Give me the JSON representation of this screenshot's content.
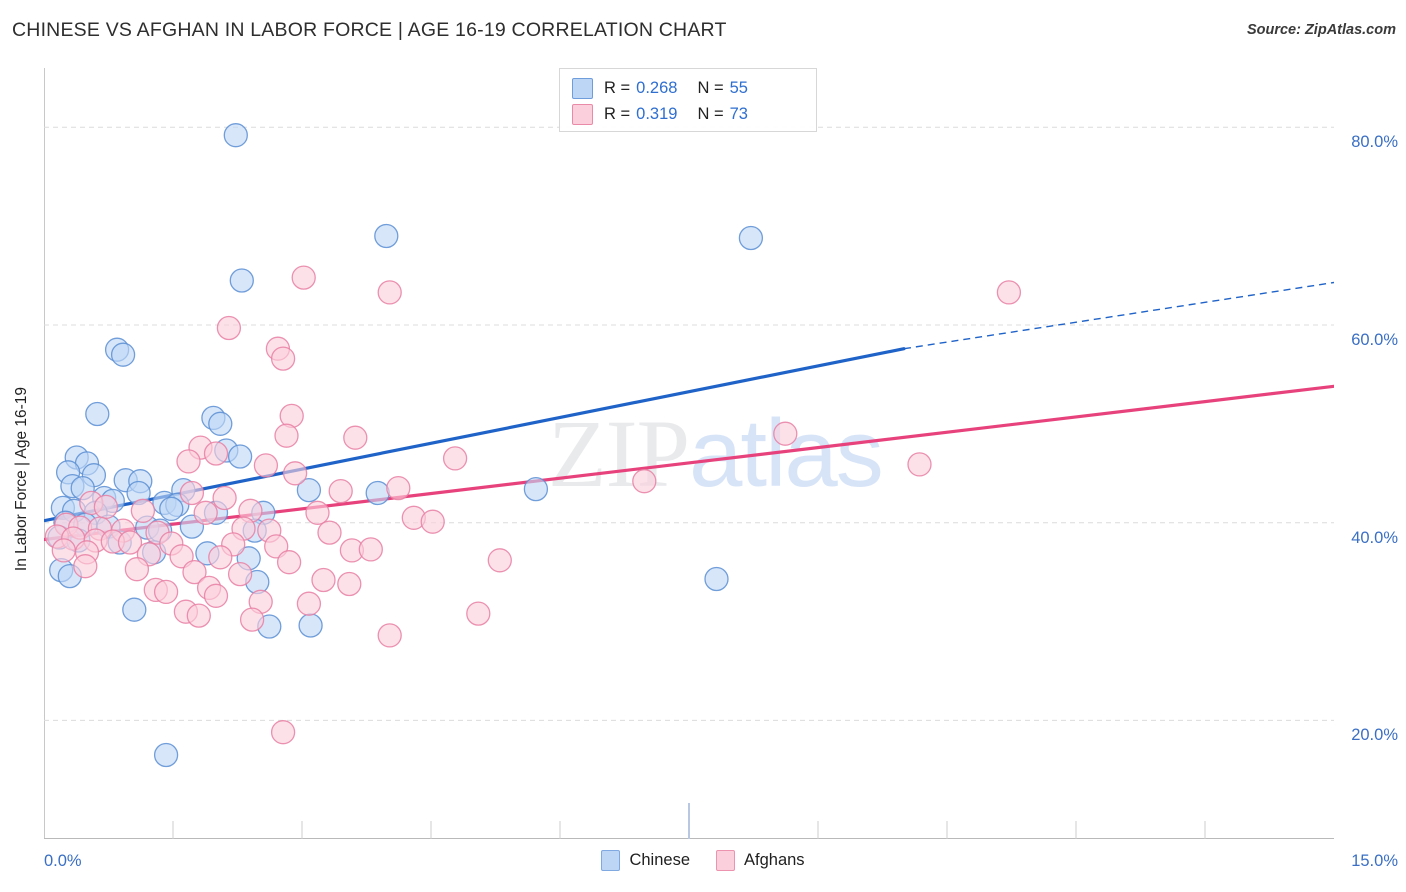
{
  "header": {
    "title": "CHINESE VS AFGHAN IN LABOR FORCE | AGE 16-19 CORRELATION CHART",
    "source": "Source: ZipAtlas.com"
  },
  "watermark": {
    "part1": "ZIP",
    "part2": "atlas"
  },
  "stat_legend": {
    "rows": [
      {
        "series": "Chinese",
        "r_key": "R =",
        "r_value": "0.268",
        "n_key": "N =",
        "n_value": "55",
        "color": "#bed6f5"
      },
      {
        "series": "Afghans",
        "r_key": "R =",
        "r_value": "0.319",
        "n_key": "N =",
        "n_value": "73",
        "color": "#fbcfdc"
      }
    ]
  },
  "series_legend": [
    {
      "label": "Chinese",
      "color": "#bed6f5"
    },
    {
      "label": "Afghans",
      "color": "#fbcfdc"
    }
  ],
  "axes": {
    "y_title": "In Labor Force | Age 16-19",
    "y_ticks": [
      "80.0%",
      "60.0%",
      "40.0%",
      "20.0%"
    ],
    "x_min_label": "0.0%",
    "x_max_label": "15.0%"
  },
  "colors": {
    "blue_fill": "#bed6f5",
    "blue_stroke": "#5b8ed4",
    "pink_fill": "#fbcfdc",
    "pink_stroke": "#e87fa3",
    "blue_trend": "#1f62c8",
    "pink_trend": "#e8427c",
    "tick_text": "#3a6fc4",
    "gridline": "#dcdcdc"
  },
  "chart_data": {
    "type": "scatter",
    "title": "CHINESE VS AFGHAN IN LABOR FORCE | AGE 16-19 CORRELATION CHART",
    "xlabel": "",
    "ylabel": "In Labor Force | Age 16-19",
    "xlim": [
      0.0,
      15.0
    ],
    "ylim": [
      8.0,
      86.0
    ],
    "x_unit": "%",
    "y_unit": "%",
    "grid": true,
    "y_gridlines": [
      20.0,
      40.0,
      60.0,
      80.0
    ],
    "legend_position": "bottom-center",
    "series": [
      {
        "name": "Chinese",
        "color": "#bed6f5",
        "stroke": "#5b8ed4",
        "R": 0.268,
        "N": 55,
        "trendline": {
          "x0": 0.0,
          "y0": 40.2,
          "x1": 10.0,
          "y1": 57.6,
          "solid_to_x": 10.0,
          "dash_to_x": 15.0,
          "dash_y1": 64.3
        },
        "points": [
          [
            2.23,
            79.2
          ],
          [
            3.98,
            69.0
          ],
          [
            8.22,
            68.8
          ],
          [
            2.3,
            64.5
          ],
          [
            0.85,
            57.5
          ],
          [
            0.92,
            57.0
          ],
          [
            0.62,
            51.0
          ],
          [
            1.97,
            50.6
          ],
          [
            2.05,
            50.0
          ],
          [
            2.12,
            47.3
          ],
          [
            2.28,
            46.7
          ],
          [
            0.38,
            46.6
          ],
          [
            0.5,
            46.0
          ],
          [
            0.28,
            45.1
          ],
          [
            0.58,
            44.8
          ],
          [
            0.95,
            44.3
          ],
          [
            1.12,
            44.2
          ],
          [
            0.33,
            43.7
          ],
          [
            0.45,
            43.5
          ],
          [
            1.1,
            43.0
          ],
          [
            1.62,
            43.3
          ],
          [
            3.08,
            43.3
          ],
          [
            3.88,
            43.0
          ],
          [
            5.72,
            43.4
          ],
          [
            0.7,
            42.5
          ],
          [
            0.8,
            42.2
          ],
          [
            1.4,
            42.0
          ],
          [
            1.55,
            41.8
          ],
          [
            0.22,
            41.5
          ],
          [
            0.35,
            41.2
          ],
          [
            0.6,
            41.0
          ],
          [
            1.48,
            41.4
          ],
          [
            2.0,
            41.0
          ],
          [
            2.55,
            41.0
          ],
          [
            0.25,
            40.0
          ],
          [
            0.48,
            39.8
          ],
          [
            0.75,
            39.6
          ],
          [
            1.2,
            39.5
          ],
          [
            1.35,
            39.2
          ],
          [
            1.72,
            39.6
          ],
          [
            2.45,
            39.2
          ],
          [
            0.18,
            38.5
          ],
          [
            0.4,
            38.2
          ],
          [
            0.88,
            38.0
          ],
          [
            1.28,
            37.0
          ],
          [
            1.9,
            36.9
          ],
          [
            2.38,
            36.4
          ],
          [
            0.2,
            35.2
          ],
          [
            0.3,
            34.6
          ],
          [
            2.48,
            34.0
          ],
          [
            7.82,
            34.3
          ],
          [
            1.05,
            31.2
          ],
          [
            2.62,
            29.5
          ],
          [
            3.1,
            29.6
          ],
          [
            1.42,
            16.5
          ]
        ]
      },
      {
        "name": "Afghans",
        "color": "#fbcfdc",
        "stroke": "#e87fa3",
        "R": 0.319,
        "N": 73,
        "trendline": {
          "x0": 0.0,
          "y0": 38.3,
          "x1": 15.0,
          "y1": 53.8
        },
        "points": [
          [
            11.22,
            63.3
          ],
          [
            3.02,
            64.8
          ],
          [
            4.02,
            63.3
          ],
          [
            2.15,
            59.7
          ],
          [
            2.72,
            57.6
          ],
          [
            2.78,
            56.6
          ],
          [
            2.88,
            50.8
          ],
          [
            2.82,
            48.8
          ],
          [
            3.62,
            48.6
          ],
          [
            1.82,
            47.6
          ],
          [
            2.0,
            47.0
          ],
          [
            8.62,
            49.0
          ],
          [
            10.18,
            45.9
          ],
          [
            4.78,
            46.5
          ],
          [
            1.68,
            46.2
          ],
          [
            2.58,
            45.8
          ],
          [
            2.92,
            45.0
          ],
          [
            6.98,
            44.2
          ],
          [
            3.45,
            43.2
          ],
          [
            4.12,
            43.5
          ],
          [
            1.72,
            43.0
          ],
          [
            2.1,
            42.5
          ],
          [
            0.55,
            42.0
          ],
          [
            0.72,
            41.6
          ],
          [
            1.15,
            41.2
          ],
          [
            1.88,
            41.0
          ],
          [
            2.4,
            41.2
          ],
          [
            3.18,
            41.0
          ],
          [
            4.3,
            40.5
          ],
          [
            4.52,
            40.1
          ],
          [
            0.26,
            39.8
          ],
          [
            0.42,
            39.5
          ],
          [
            0.65,
            39.4
          ],
          [
            0.92,
            39.2
          ],
          [
            1.32,
            39.0
          ],
          [
            2.32,
            39.4
          ],
          [
            2.62,
            39.2
          ],
          [
            3.32,
            39.0
          ],
          [
            0.15,
            38.6
          ],
          [
            0.34,
            38.4
          ],
          [
            0.6,
            38.2
          ],
          [
            0.8,
            38.1
          ],
          [
            1.0,
            38.0
          ],
          [
            1.48,
            37.9
          ],
          [
            2.2,
            37.8
          ],
          [
            2.7,
            37.6
          ],
          [
            3.58,
            37.2
          ],
          [
            3.8,
            37.3
          ],
          [
            0.23,
            37.2
          ],
          [
            0.5,
            37.0
          ],
          [
            1.22,
            36.8
          ],
          [
            1.6,
            36.6
          ],
          [
            2.05,
            36.5
          ],
          [
            2.85,
            36.0
          ],
          [
            5.3,
            36.2
          ],
          [
            0.48,
            35.6
          ],
          [
            1.08,
            35.3
          ],
          [
            1.75,
            35.0
          ],
          [
            2.28,
            34.8
          ],
          [
            3.25,
            34.2
          ],
          [
            3.55,
            33.8
          ],
          [
            1.3,
            33.2
          ],
          [
            1.42,
            33.0
          ],
          [
            1.92,
            33.4
          ],
          [
            2.0,
            32.6
          ],
          [
            2.52,
            32.0
          ],
          [
            3.08,
            31.8
          ],
          [
            5.05,
            30.8
          ],
          [
            1.65,
            31.0
          ],
          [
            1.8,
            30.6
          ],
          [
            2.42,
            30.2
          ],
          [
            4.02,
            28.6
          ],
          [
            2.78,
            18.8
          ]
        ]
      }
    ]
  }
}
